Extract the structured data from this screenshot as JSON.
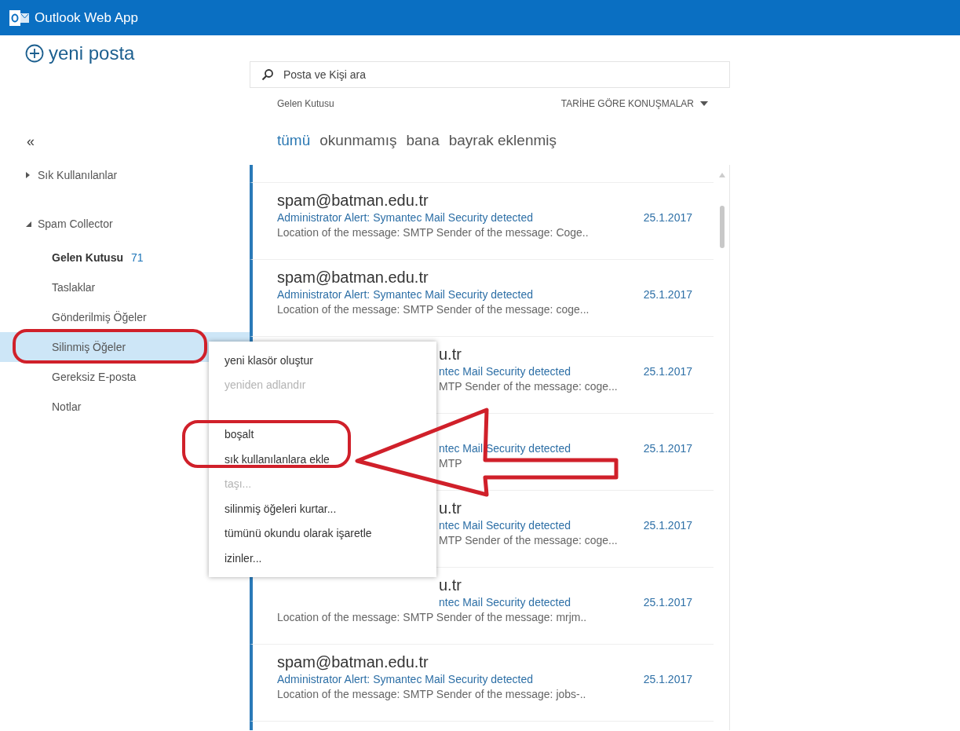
{
  "header": {
    "title": "Outlook Web App"
  },
  "new_mail": {
    "label": "yeni posta"
  },
  "collapse": {
    "label": "«"
  },
  "folders": [
    {
      "label": "Sık Kullanılanlar",
      "expanded": false
    },
    {
      "label": "Spam Collector",
      "expanded": true,
      "children": [
        {
          "label": "Gelen Kutusu",
          "count": "71",
          "unread": true,
          "selected": false
        },
        {
          "label": "Taslaklar",
          "unread": false,
          "selected": false
        },
        {
          "label": "Gönderilmiş Öğeler",
          "unread": false,
          "selected": false
        },
        {
          "label": "Silinmiş Öğeler",
          "unread": false,
          "selected": true
        },
        {
          "label": "Gereksiz E-posta",
          "unread": false,
          "selected": false
        },
        {
          "label": "Notlar",
          "unread": false,
          "selected": false
        }
      ]
    }
  ],
  "search": {
    "placeholder": "Posta ve Kişi ara"
  },
  "list_header": {
    "folder": "Gelen Kutusu",
    "sort": "TARİHE GÖRE KONUŞMALAR"
  },
  "filters": [
    {
      "label": "tümü",
      "selected": true
    },
    {
      "label": "okunmamış",
      "selected": false
    },
    {
      "label": "bana",
      "selected": false
    },
    {
      "label": "bayrak eklenmiş",
      "selected": false
    }
  ],
  "messages": [
    {
      "kind": "full",
      "sender": "spam@batman.edu.tr",
      "subject": "Administrator Alert: Symantec Mail Security detected",
      "date": "25.1.2017",
      "preview": "Location of the message: SMTP Sender of the message: Coge.."
    },
    {
      "kind": "full",
      "sender": "spam@batman.edu.tr",
      "subject": "Administrator Alert: Symantec Mail Security detected",
      "date": "25.1.2017",
      "preview": "Location of the message: SMTP Sender of the message: coge..."
    },
    {
      "kind": "covered",
      "sender": "u.tr",
      "subject": "ntec Mail Security detected",
      "date": "25.1.2017",
      "preview": "MTP Sender of the message: coge..."
    },
    {
      "kind": "covered",
      "subject": "ntec Mail Security detected",
      "date": "25.1.2017",
      "preview": "MTP"
    },
    {
      "kind": "covered",
      "sender": "u.tr",
      "subject": "ntec Mail Security detected",
      "date": "25.1.2017",
      "preview": "MTP Sender of the message: coge..."
    },
    {
      "kind": "partly",
      "sender": "u.tr",
      "subject": "ntec Mail Security detected",
      "date": "25.1.2017",
      "preview": "Location of the message: SMTP Sender of the message: mrjm.."
    },
    {
      "kind": "full",
      "sender": "spam@batman.edu.tr",
      "subject": "Administrator Alert: Symantec Mail Security detected",
      "date": "25.1.2017",
      "preview": "Location of the message: SMTP Sender of the message: jobs-.."
    }
  ],
  "context_menu": [
    {
      "label": "yeni klasör oluştur",
      "disabled": false
    },
    {
      "label": "yeniden adlandır",
      "disabled": true
    },
    {
      "label": "boşalt",
      "disabled": false
    },
    {
      "label": "sık kullanılanlara ekle",
      "disabled": false
    },
    {
      "label": "taşı...",
      "disabled": true
    },
    {
      "label": "silinmiş öğeleri kurtar...",
      "disabled": false
    },
    {
      "label": "tümünü okundu olarak işaretle",
      "disabled": false
    },
    {
      "label": "izinler...",
      "disabled": false
    }
  ]
}
